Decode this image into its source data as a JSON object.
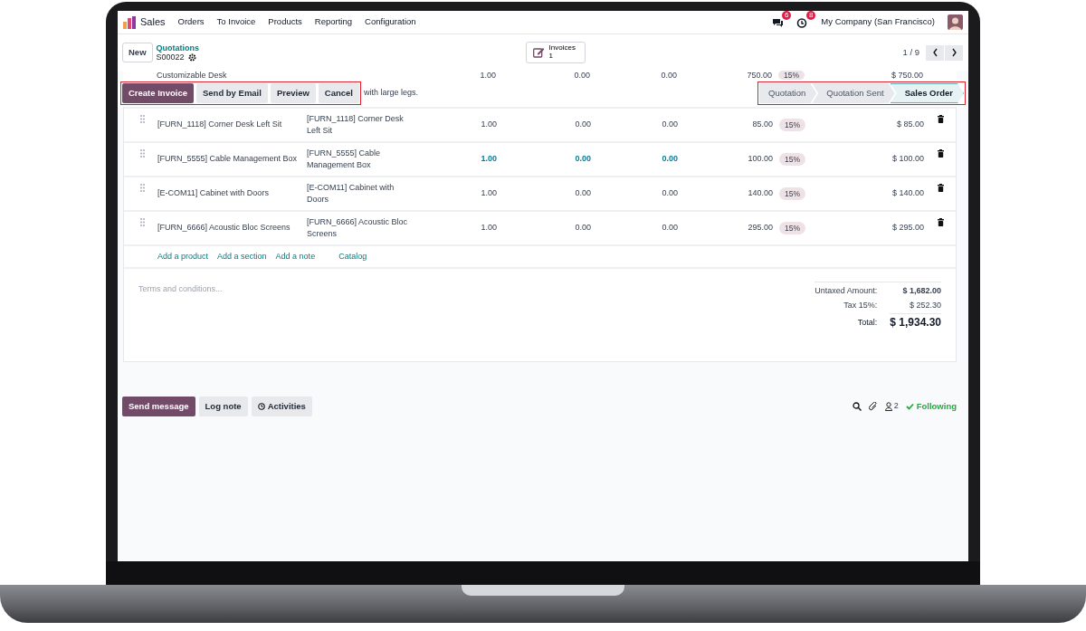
{
  "app": {
    "name": "Sales",
    "menu": [
      "Orders",
      "To Invoice",
      "Products",
      "Reporting",
      "Configuration"
    ],
    "messages_badge": "6",
    "activities_badge": "8",
    "company": "My Company (San Francisco)"
  },
  "control": {
    "new_button": "New",
    "breadcrumb": "Quotations",
    "record": "S00022",
    "smart_button": {
      "label": "Invoices",
      "count": "1"
    },
    "pager": "1 / 9"
  },
  "partial_line": {
    "product": "Customizable Desk",
    "description": "with large legs.",
    "column_3": "1.00",
    "column_4": "0.00",
    "column_5": "0.00",
    "column_6": "750.00",
    "tax": "15%",
    "subtotal": "$ 750.00"
  },
  "action_bar": {
    "highlighted": true,
    "buttons": [
      {
        "label": "Create Invoice",
        "primary": true
      },
      {
        "label": "Send by Email",
        "primary": false
      },
      {
        "label": "Preview",
        "primary": false
      },
      {
        "label": "Cancel",
        "primary": false
      }
    ]
  },
  "stage_bar": {
    "highlighted": true,
    "stages": [
      {
        "label": "Quotation",
        "selected": false
      },
      {
        "label": "Quotation Sent",
        "selected": false
      },
      {
        "label": "Sales Order",
        "selected": true
      }
    ]
  },
  "lines": [
    {
      "product": "[FURN_1118] Corner Desk Left Sit",
      "description": "[FURN_1118] Corner Desk Left Sit",
      "column_3": "1.00",
      "column_4": "0.00",
      "column_5": "0.00",
      "column_6": "85.00",
      "tax": "15%",
      "subtotal": "$ 85.00",
      "highlighted": false
    },
    {
      "product": "[FURN_5555] Cable Management Box",
      "description": "[FURN_5555] Cable Management Box",
      "column_3": "1.00",
      "column_4": "0.00",
      "column_5": "0.00",
      "column_6": "100.00",
      "tax": "15%",
      "subtotal": "$ 100.00",
      "highlighted": true
    },
    {
      "product": "[E-COM11] Cabinet with Doors",
      "description": "[E-COM11] Cabinet with Doors",
      "column_3": "1.00",
      "column_4": "0.00",
      "column_5": "0.00",
      "column_6": "140.00",
      "tax": "15%",
      "subtotal": "$ 140.00",
      "highlighted": false
    },
    {
      "product": "[FURN_6666] Acoustic Bloc Screens",
      "description": "[FURN_6666] Acoustic Bloc Screens",
      "column_3": "1.00",
      "column_4": "0.00",
      "column_5": "0.00",
      "column_6": "295.00",
      "tax": "15%",
      "subtotal": "$ 295.00",
      "highlighted": false
    }
  ],
  "add_links": [
    "Add a product",
    "Add a section",
    "Add a note",
    "Catalog"
  ],
  "terms_placeholder": "Terms and conditions...",
  "totals": [
    {
      "label": "Untaxed Amount:",
      "value": "$ 1,682.00",
      "kind": "subtotal"
    },
    {
      "label": "Tax 15%:",
      "value": "$ 252.30",
      "kind": "tax"
    },
    {
      "label": "Total:",
      "value": "$ 1,934.30",
      "kind": "total"
    }
  ],
  "chatter": {
    "buttons": [
      {
        "label": "Send message",
        "primary": true,
        "kind": "plain"
      },
      {
        "label": "Log note",
        "primary": false,
        "kind": "plain"
      },
      {
        "label": "Activities",
        "primary": false,
        "kind": "clock"
      }
    ],
    "followers": "2",
    "following": "Following"
  }
}
